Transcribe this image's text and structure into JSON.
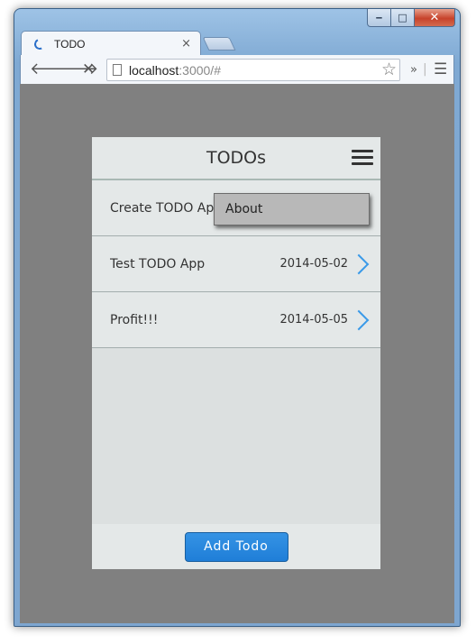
{
  "browser": {
    "tab_title": "TODO",
    "tab_close_glyph": "×",
    "url_host": "localhost",
    "url_rest": ":3000/#",
    "icons": [
      "back-icon",
      "forward-icon",
      "stop-icon",
      "page-icon",
      "star-icon",
      "chevron-double-icon",
      "menu-icon"
    ]
  },
  "app": {
    "title": "TODOs",
    "todos": [
      {
        "name": "Create TODO App",
        "date": ""
      },
      {
        "name": "Test TODO App",
        "date": "2014-05-02"
      },
      {
        "name": "Profit!!!",
        "date": "2014-05-05"
      }
    ],
    "menu": {
      "items": [
        {
          "label": "About"
        }
      ]
    },
    "add_button_label": "Add Todo",
    "colors": {
      "accent": "#2a8ae2",
      "chevron": "#3a9ae8",
      "backdrop": "#808080"
    }
  }
}
